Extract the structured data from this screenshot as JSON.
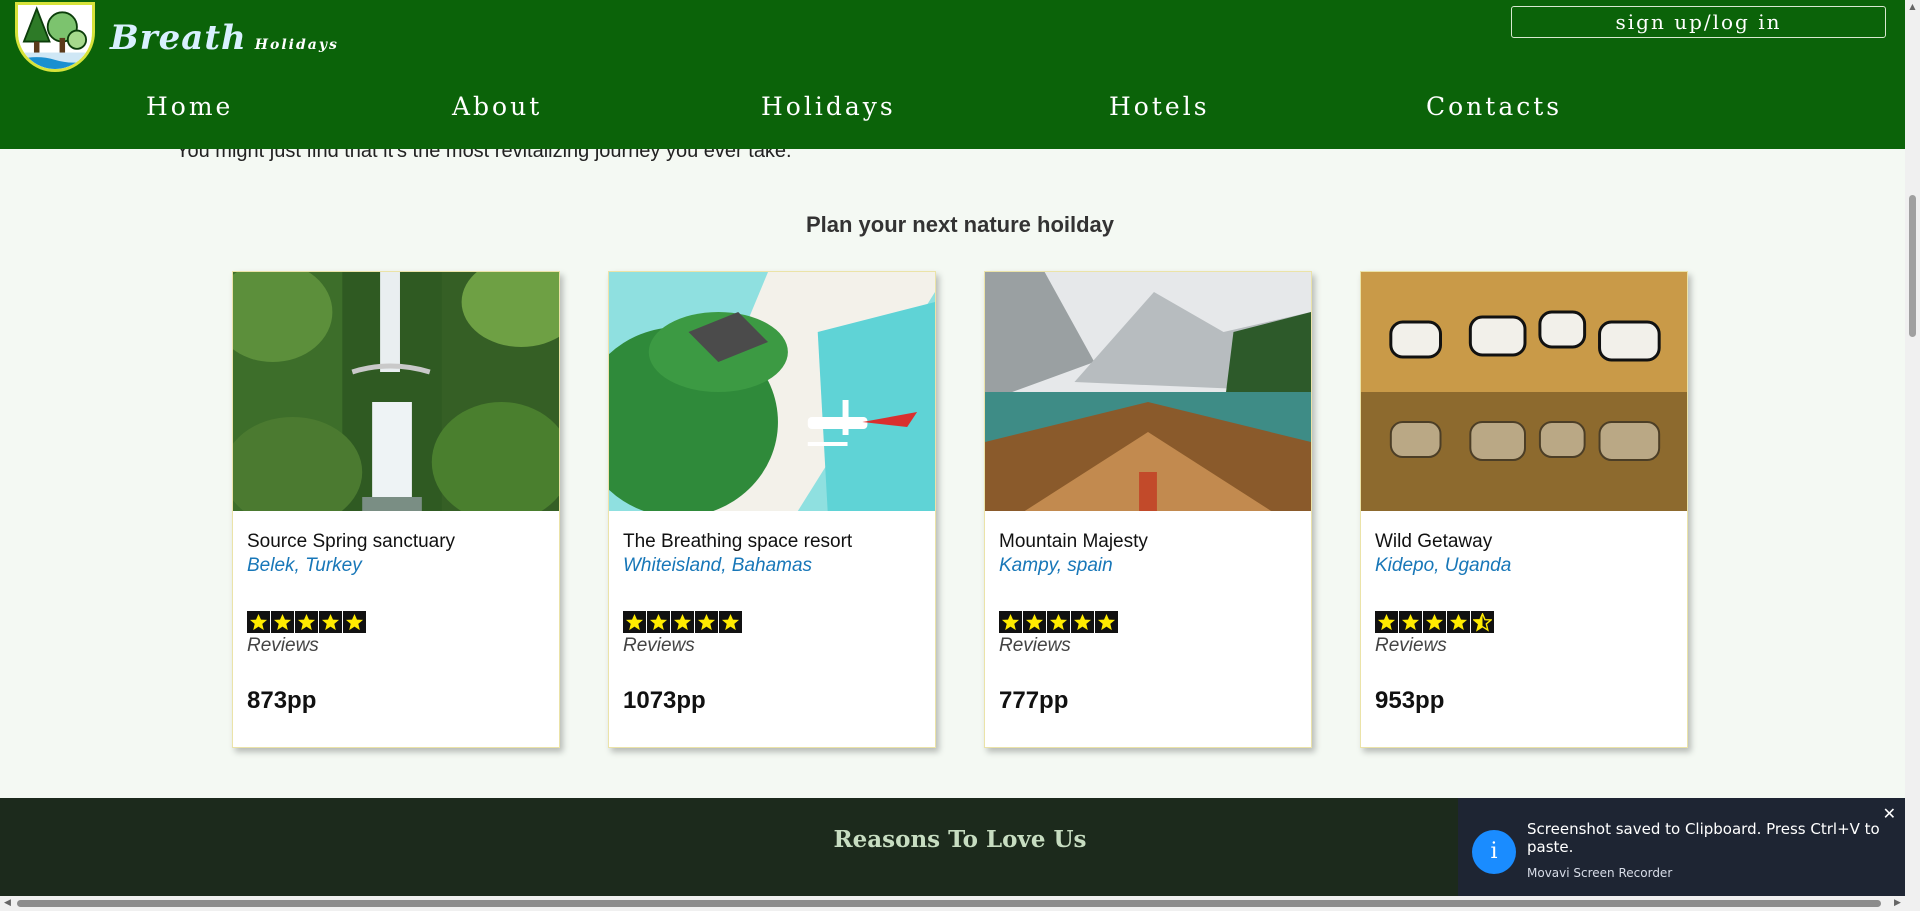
{
  "header": {
    "brand_main": "Breath",
    "brand_sub": "Holidays",
    "signin_label": "sign up/log in",
    "nav": [
      "Home",
      "About",
      "Holidays",
      "Hotels",
      "Contacts"
    ]
  },
  "main": {
    "intro_text": "You might just find that it's the most revitalizing journey you ever take.",
    "section_title": "Plan your next nature hoilday",
    "cards": [
      {
        "title": "Source Spring sanctuary",
        "location": "Belek, Turkey",
        "rating": 5,
        "reviews_label": "Reviews",
        "price": "873pp",
        "image": "waterfall"
      },
      {
        "title": "The Breathing space resort",
        "location": "Whiteisland, Bahamas",
        "rating": 5,
        "reviews_label": "Reviews",
        "price": "1073pp",
        "image": "beach-seaplane"
      },
      {
        "title": "Mountain Majesty",
        "location": "Kampy, spain",
        "rating": 5,
        "reviews_label": "Reviews",
        "price": "777pp",
        "image": "mountain-lake-boat"
      },
      {
        "title": "Wild Getaway",
        "location": "Kidepo, Uganda",
        "rating": 4.5,
        "reviews_label": "Reviews",
        "price": "953pp",
        "image": "zebras"
      }
    ]
  },
  "footer": {
    "title": "Reasons To Love Us"
  },
  "toast": {
    "message": "Screenshot saved to Clipboard. Press Ctrl+V to paste.",
    "app": "Movavi Screen Recorder",
    "icon": "info-icon",
    "close": "✕"
  },
  "colors": {
    "header_bg": "#0b6309",
    "page_bg": "#f4f9f3",
    "location_blue": "#1877b8",
    "footer_bg": "#1c2a1c",
    "toast_bg": "#1e2533",
    "toast_icon": "#1a8cff"
  }
}
